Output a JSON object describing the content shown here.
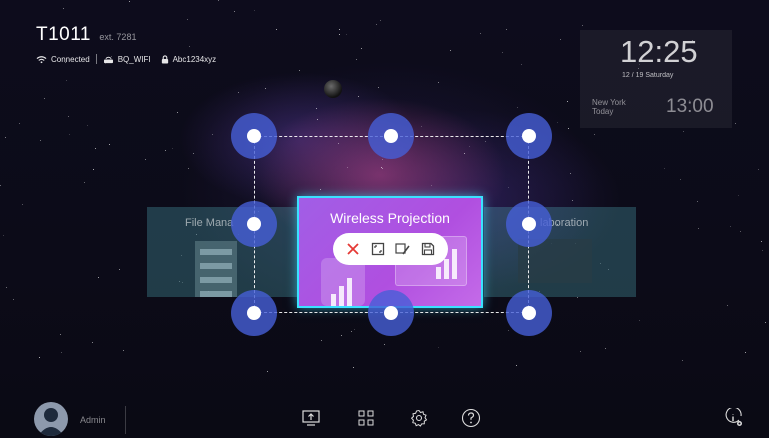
{
  "header": {
    "room": "T1011",
    "ext": "ext. 7281",
    "network_status": "Connected",
    "wifi_name": "BQ_WIFI",
    "wifi_password": "Abc1234xyz"
  },
  "clock": {
    "time": "12:25",
    "date": "12 / 19 Saturday",
    "second_city": "New York",
    "second_day": "Today",
    "second_time": "13:00"
  },
  "tiles": {
    "file_manager": "File Mana",
    "collaboration": "laboration"
  },
  "widget": {
    "title": "Wireless Projection",
    "accent_color": "#3be1ff",
    "handle_color": "#4a60d8",
    "toolbar": [
      "close-icon",
      "fullscreen-icon",
      "edit-icon",
      "save-icon"
    ]
  },
  "bottom": {
    "user": "Admin",
    "icons": [
      "screen-share-icon",
      "apps-grid-icon",
      "settings-icon",
      "help-icon",
      "info-settings-icon"
    ]
  }
}
